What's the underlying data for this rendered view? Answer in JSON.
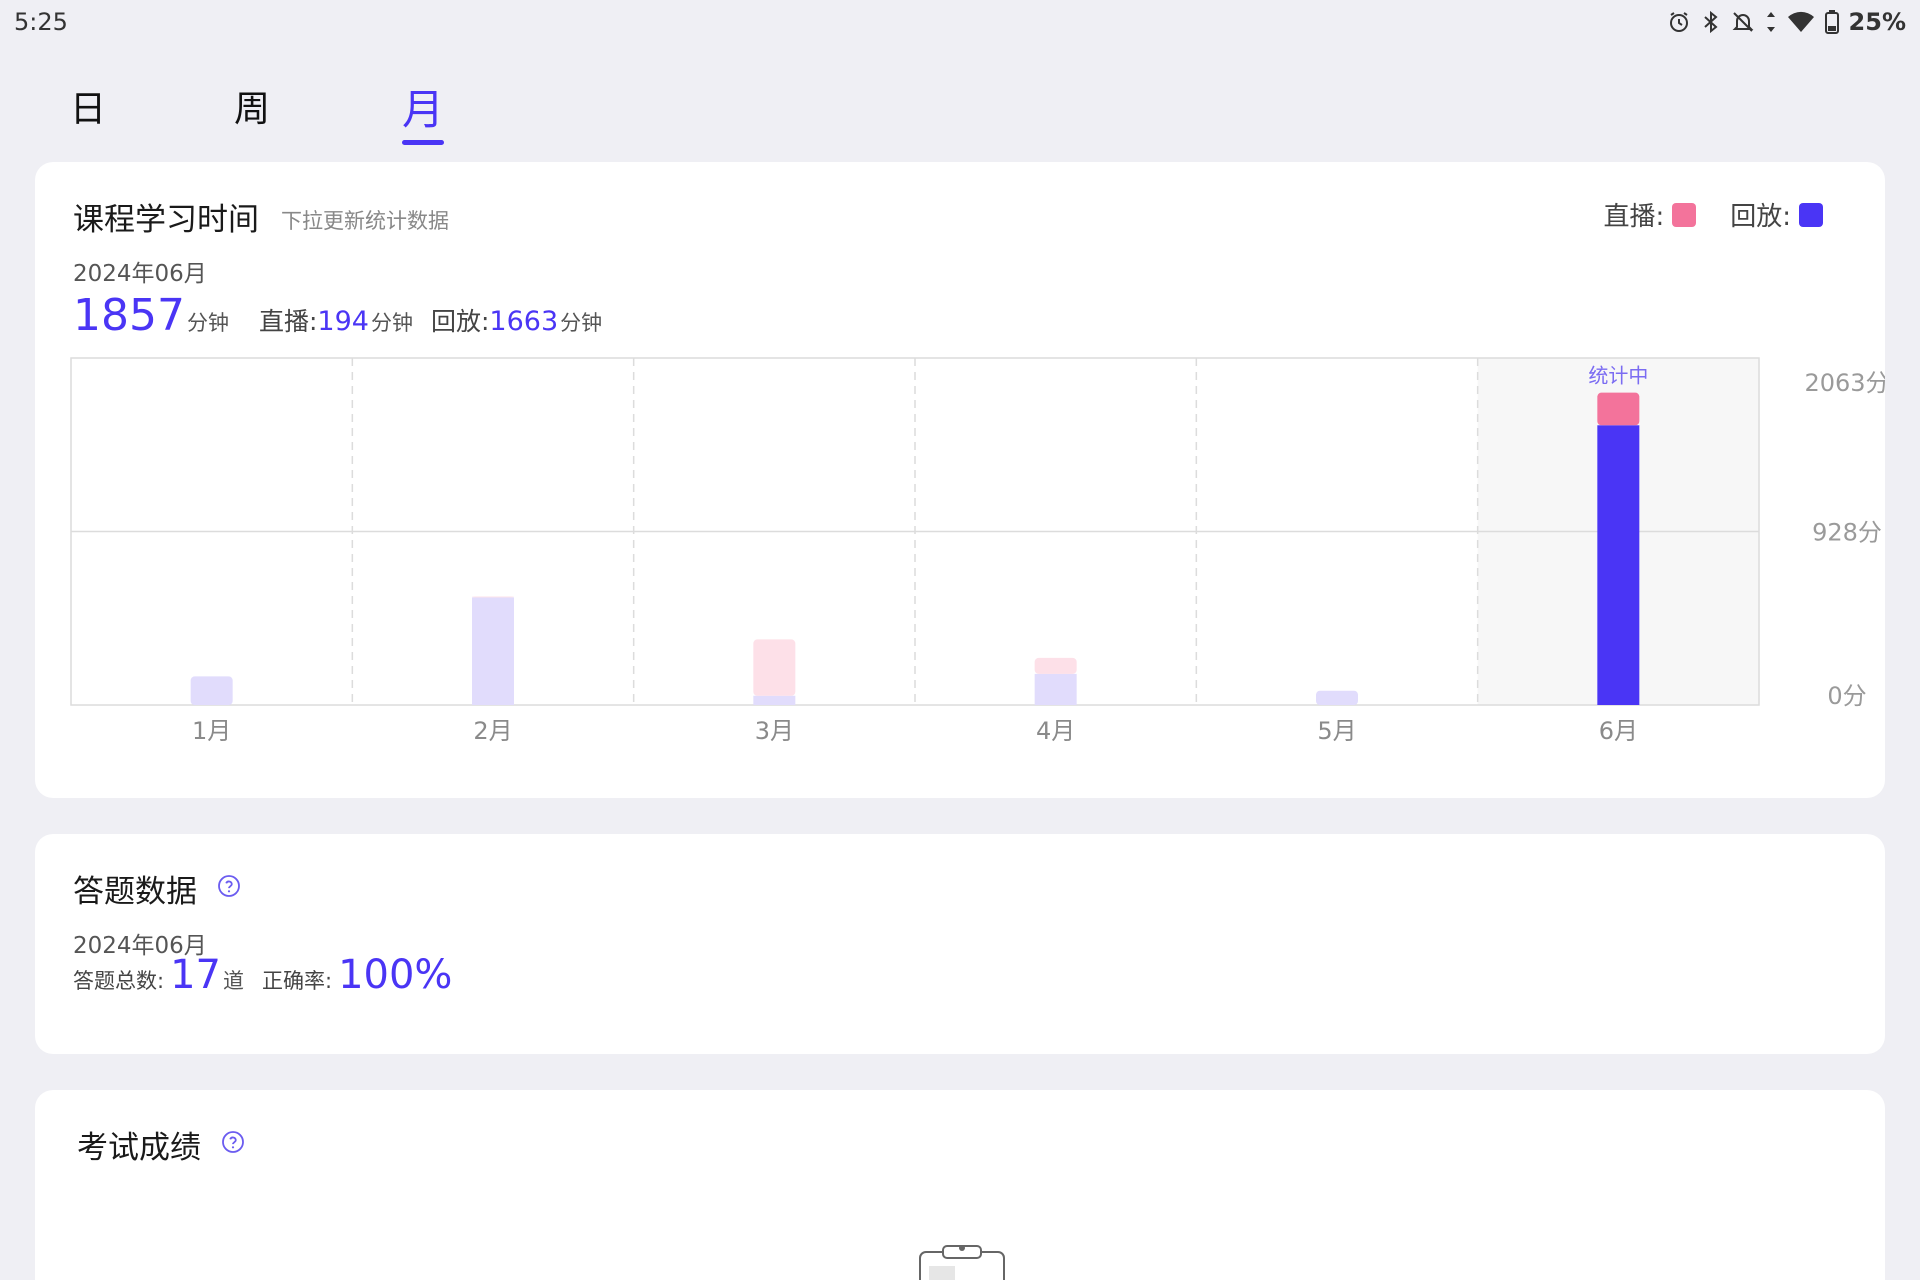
{
  "status_bar": {
    "time": "5:25",
    "battery": "25%"
  },
  "tabs": [
    {
      "label": "日",
      "active": false
    },
    {
      "label": "周",
      "active": false
    },
    {
      "label": "月",
      "active": true
    }
  ],
  "study": {
    "title": "课程学习时间",
    "subtitle": "下拉更新统计数据",
    "legend": {
      "live": "直播:",
      "replay": "回放:"
    },
    "date": "2024年06月",
    "total": "1857",
    "total_unit": "分钟",
    "live_label": "直播:",
    "live_value": "194",
    "live_unit": "分钟",
    "replay_label": "回放:",
    "replay_value": "1663",
    "replay_unit": "分钟"
  },
  "chart_data": {
    "type": "bar",
    "stacked": true,
    "categories": [
      "1月",
      "2月",
      "3月",
      "4月",
      "5月",
      "6月"
    ],
    "series": [
      {
        "name": "回放",
        "values": [
          170,
          640,
          55,
          185,
          85,
          1663
        ]
      },
      {
        "name": "直播",
        "values": [
          0,
          5,
          335,
          95,
          0,
          194
        ]
      }
    ],
    "y_tick_labels": [
      "2063分",
      "928分",
      "0分"
    ],
    "ylim": [
      0,
      2063
    ],
    "highlight_category": "6月",
    "highlight_label": "统计中",
    "colors": {
      "replay": "#4a35f5",
      "live": "#f3739b",
      "replay_faded": "#e1dcfc",
      "live_faded": "#fde0e8",
      "grid": "#dcdcdc",
      "highlight_bg": "#f7f7f7"
    }
  },
  "answers": {
    "title": "答题数据",
    "date": "2024年06月",
    "total_label": "答题总数:",
    "total_value": "17",
    "total_unit": "道",
    "accuracy_label": "正确率:",
    "accuracy_value": "100%"
  },
  "exam": {
    "title": "考试成绩"
  },
  "icons": {
    "help": "question-circle-icon",
    "empty": "clipboard-icon"
  }
}
